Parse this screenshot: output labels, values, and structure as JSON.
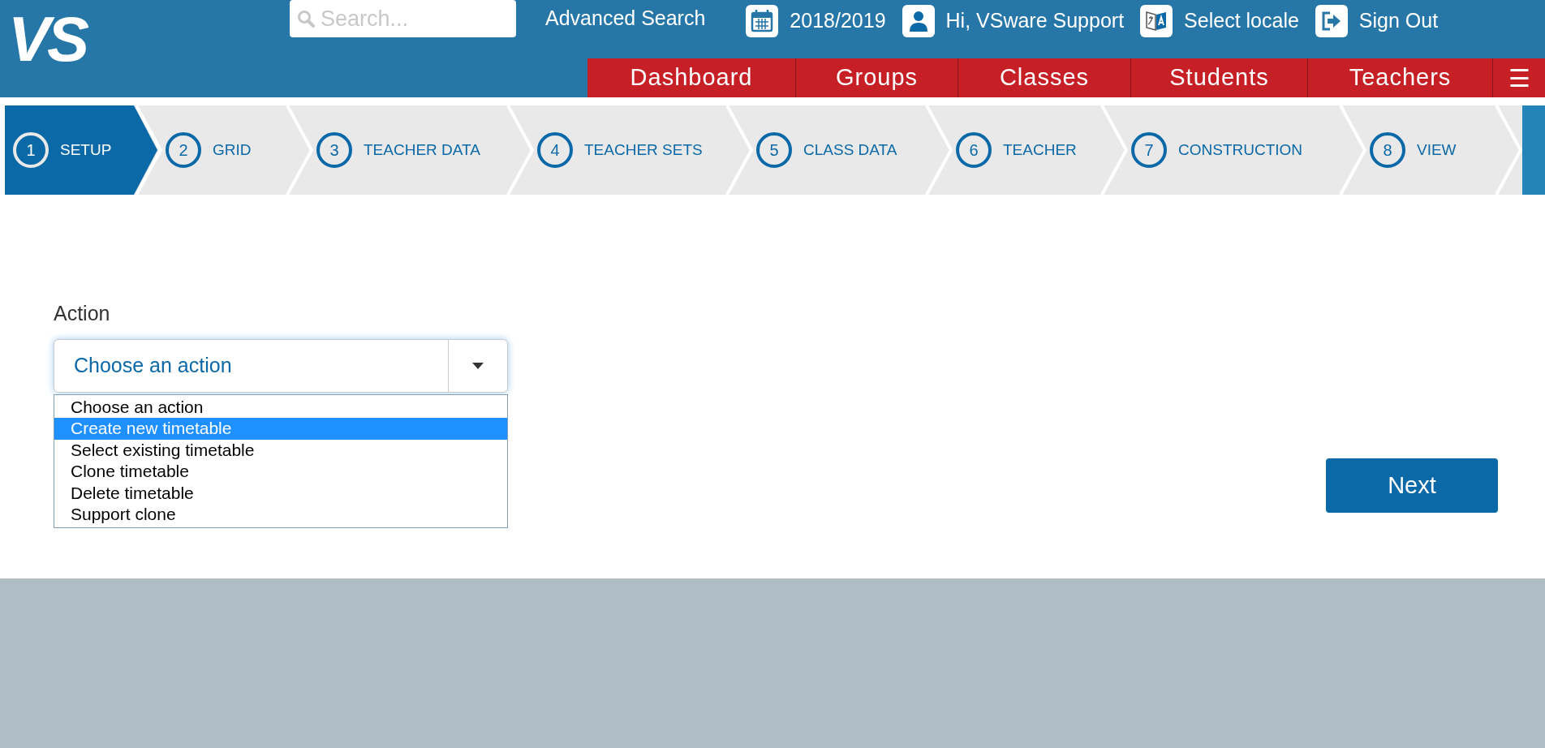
{
  "header": {
    "logo": "VS",
    "search": {
      "placeholder": "Search..."
    },
    "advanced_search": "Advanced Search",
    "year": "2018/2019",
    "user": "Hi, VSware Support",
    "locale": "Select locale",
    "sign_out": "Sign Out"
  },
  "nav": {
    "items": [
      "Dashboard",
      "Groups",
      "Classes",
      "Students",
      "Teachers"
    ],
    "menu": "☰"
  },
  "steps": [
    {
      "number": "1",
      "label": "SETUP",
      "selected": true
    },
    {
      "number": "2",
      "label": "GRID",
      "selected": false
    },
    {
      "number": "3",
      "label": "TEACHER DATA",
      "selected": false
    },
    {
      "number": "4",
      "label": "TEACHER SETS",
      "selected": false
    },
    {
      "number": "5",
      "label": "CLASS DATA",
      "selected": false
    },
    {
      "number": "6",
      "label": "TEACHER",
      "selected": false
    },
    {
      "number": "7",
      "label": "CONSTRUCTION",
      "selected": false
    },
    {
      "number": "8",
      "label": "VIEW",
      "selected": false
    }
  ],
  "form": {
    "label": "Action",
    "select": {
      "value": "Choose an action",
      "expanded": true,
      "options": [
        {
          "label": "Choose an action",
          "highlighted": false
        },
        {
          "label": "Create new timetable",
          "highlighted": true
        },
        {
          "label": "Select existing timetable",
          "highlighted": false
        },
        {
          "label": "Clone timetable",
          "highlighted": false
        },
        {
          "label": "Delete timetable",
          "highlighted": false
        },
        {
          "label": "Support clone",
          "highlighted": false
        }
      ]
    }
  },
  "next_button": "Next"
}
